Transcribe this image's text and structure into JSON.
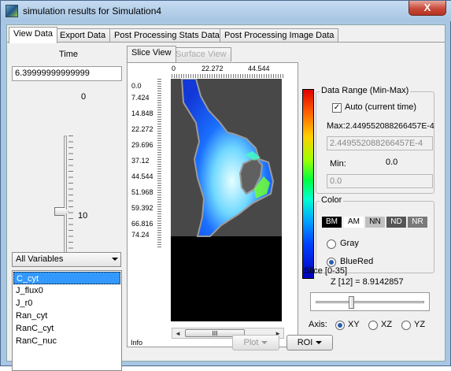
{
  "window": {
    "title": "simulation results for Simulation4",
    "close": "X"
  },
  "tabs": [
    "View Data",
    "Export Data",
    "Post Processing Stats Data",
    "Post Processing Image Data"
  ],
  "time": {
    "label": "Time",
    "value": "6.39999999999999",
    "slider_max_label": "0",
    "slider_min_label": "10",
    "slider_position": 0.64
  },
  "variables": {
    "filter": "All Variables",
    "items": [
      "C_cyt",
      "J_flux0",
      "J_r0",
      "Ran_cyt",
      "RanC_cyt",
      "RanC_nuc"
    ],
    "selected": "C_cyt"
  },
  "viewer": {
    "tabs": [
      "Slice View",
      "Surface View"
    ],
    "x_ticks": [
      "0",
      "22.272",
      "44.544"
    ],
    "y_ticks": [
      "0.0",
      "7.424",
      "14.848",
      "22.272",
      "29.696",
      "37.12",
      "44.544",
      "51.968",
      "59.392",
      "66.816",
      "74.24"
    ],
    "scroll_grip": "III",
    "scroll_left": "◄",
    "scroll_right": "►",
    "info_label": "Info"
  },
  "data_range": {
    "title": "Data Range (Min-Max)",
    "auto_label": "Auto (current time)",
    "auto_checked": true,
    "max_label": "Max:",
    "max_value": "2.449552088266457E-4",
    "max_field": "2.449552088266457E-4",
    "min_label": "Min:",
    "min_value": "0.0",
    "min_field": "0.0"
  },
  "color": {
    "title": "Color",
    "colormaps": [
      "BM",
      "AM",
      "NN",
      "ND",
      "NR"
    ],
    "gray_label": "Gray",
    "bluered_label": "BlueRed",
    "selected": "BlueRed",
    "colorbar_colors": [
      "#e00000",
      "#ffd000",
      "#00ff40",
      "#00a0ff",
      "#0000c0"
    ]
  },
  "slice": {
    "title": "Slice [0-35]",
    "z_label": "Z [12] = 8.9142857",
    "position": 0.34,
    "axis_label": "Axis:",
    "axes": [
      "XY",
      "XZ",
      "YZ"
    ],
    "selected_axis": "XY"
  },
  "buttons": {
    "plot": "Plot",
    "roi": "ROI"
  }
}
